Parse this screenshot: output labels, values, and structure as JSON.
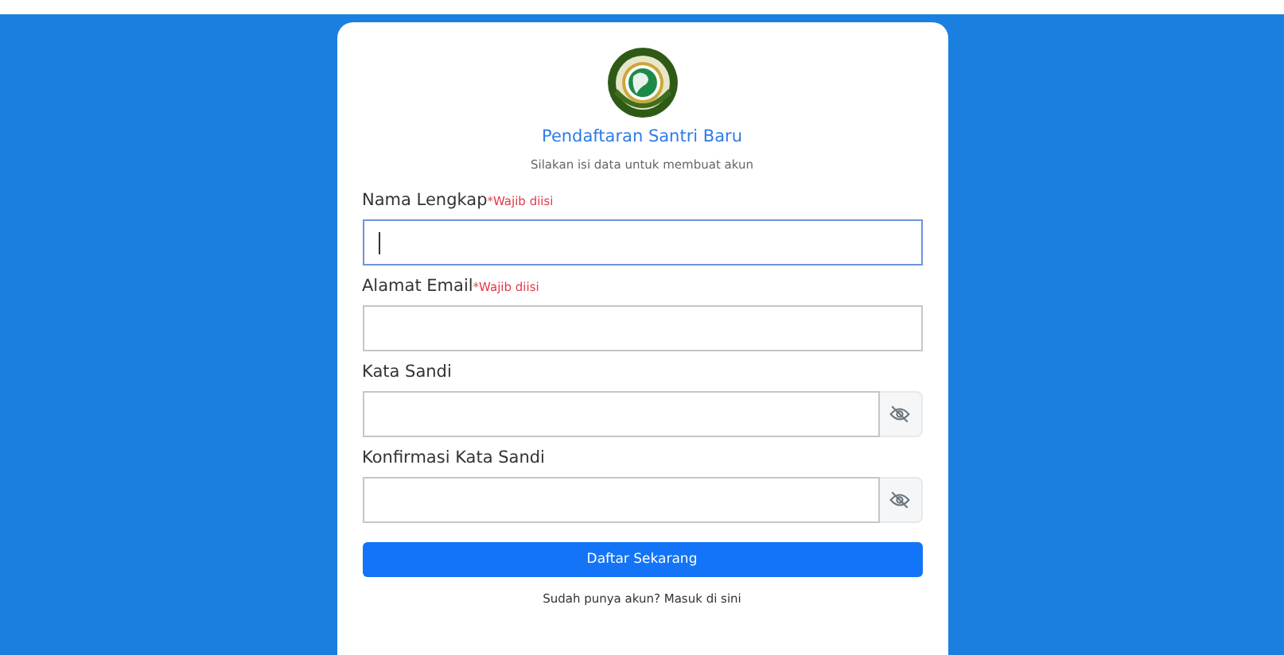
{
  "form": {
    "title": "Pendaftaran Santri Baru",
    "subtitle": "Silakan isi data untuk membuat akun",
    "fields": [
      {
        "kind": "text",
        "label": "Nama Lengkap",
        "required_note": "*Wajib diisi",
        "focused": true
      },
      {
        "kind": "text",
        "label": "Alamat Email",
        "required_note": "*Wajib diisi",
        "focused": false
      },
      {
        "kind": "password",
        "label": "Kata Sandi",
        "focused": false
      },
      {
        "kind": "password",
        "label": "Konfirmasi Kata Sandi",
        "focused": false
      }
    ],
    "submit": "Daftar Sekarang",
    "login_link": "Sudah punya akun? Masuk di sini"
  }
}
